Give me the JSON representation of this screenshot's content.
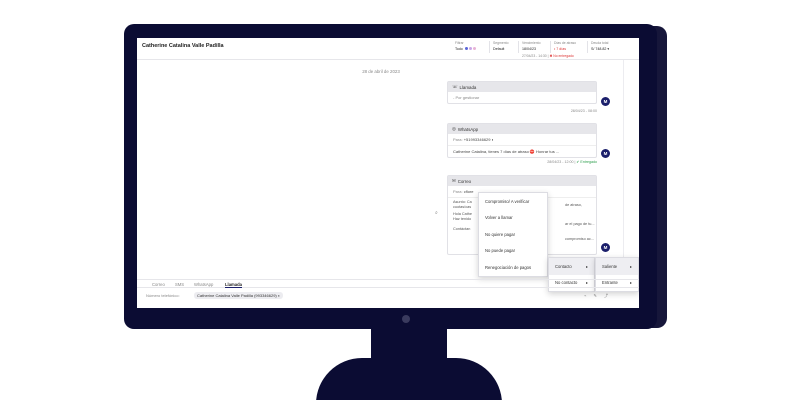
{
  "header": {
    "contact_name": "Catherine Catalina Valle Padilla",
    "filter": {
      "label": "Filtrar",
      "value": "Todo",
      "dot_colors": [
        "#5a66d8",
        "#c8a6e8",
        "#e7b3d6"
      ]
    },
    "segmento": {
      "label": "Segmento",
      "value": "Default"
    },
    "vencimiento": {
      "label": "Vencimiento",
      "value": "18/04/23"
    },
    "dias_atraso": {
      "label": "Días de atraso",
      "value": "• 7 días"
    },
    "deuda_total": {
      "label": "Deuda total",
      "value": "S/ 748.82 ▾"
    },
    "top_status": {
      "time": "27/04/23 - 14:30 |",
      "status": "✖ No entregado"
    }
  },
  "timeline": {
    "date_separator": "28 de abril de 2023",
    "cards": [
      {
        "type": "Llamada",
        "icon": "phone-icon",
        "body": "- Por gestionar",
        "timestamp": "28/04/23 - 08:00",
        "avatar": "M"
      },
      {
        "type": "WhatsApp",
        "icon": "whatsapp-icon",
        "para_label": "Para:",
        "para_value": "+51993346629",
        "body": "Catherine Catalina, tienes 7 días de atraso ⛔ Honrar tus ...",
        "timestamp": "28/04/23 - 12:00 |",
        "status": "✔ Entregado",
        "avatar": "M"
      },
      {
        "type": "Correo",
        "icon": "mail-icon",
        "para_label": "Para:",
        "para_value": "cflore",
        "lines": [
          "Asunto: Ca",
          "cuotas/cas",
          "Hola Cathe",
          "Haz tenido",
          "Contáctan"
        ],
        "right_fragments": [
          "de atraso,",
          "ar el pago de tu...",
          "compromiso ac..."
        ],
        "avatar": "M"
      }
    ]
  },
  "context_menu": {
    "main": [
      "Compromiso/ A verificar",
      "Volver a llamar",
      "No quiere pagar",
      "No puede pagar",
      "Renegociación de pagos"
    ],
    "contacto": [
      "Contacto",
      "No contacto"
    ],
    "direction": [
      "Saliente",
      "Entrante"
    ]
  },
  "tabs": [
    "Correo",
    "SMS",
    "WhatsApp",
    "Llamada"
  ],
  "active_tab": "Llamada",
  "number_row": {
    "label": "Número telefónico:",
    "value": "Catherine Catalina Valle Padilla (993346629)",
    "tools": "⌁ ✎ ⤴"
  },
  "colors": {
    "monitor": "#0b0c33",
    "avatar": "#1b1f6b",
    "delivered": "#2a9d4a",
    "not_delivered": "#d33333"
  }
}
